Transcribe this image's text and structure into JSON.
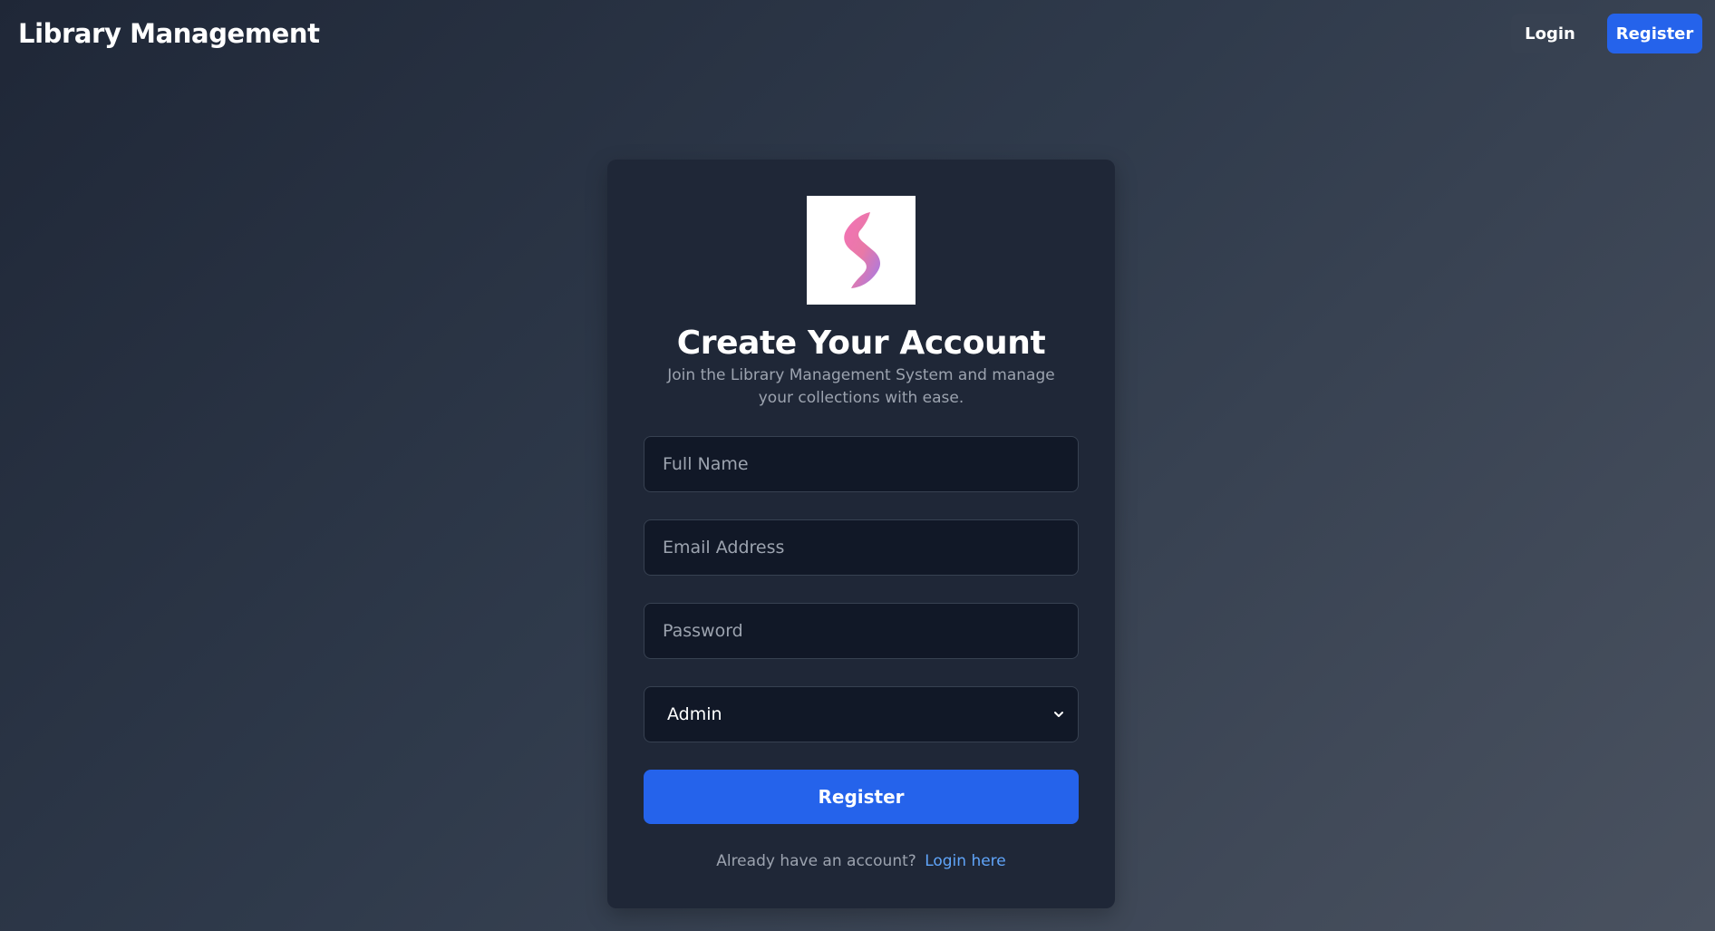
{
  "header": {
    "brand": "Library Management",
    "login_label": "Login",
    "register_label": "Register"
  },
  "card": {
    "logo_icon": "s-logo-icon",
    "title": "Create Your Account",
    "subtitle": "Join the Library Management System and manage your collections with ease.",
    "form": {
      "full_name_placeholder": "Full Name",
      "email_placeholder": "Email Address",
      "password_placeholder": "Password",
      "role_selected": "Admin",
      "submit_label": "Register"
    },
    "footer": {
      "prompt_text": "Already have an account?",
      "login_link_label": "Login here"
    }
  },
  "colors": {
    "accent": "#2563eb",
    "card_bg": "#1f2737",
    "field_bg": "#111827",
    "link": "#60a5fa"
  }
}
